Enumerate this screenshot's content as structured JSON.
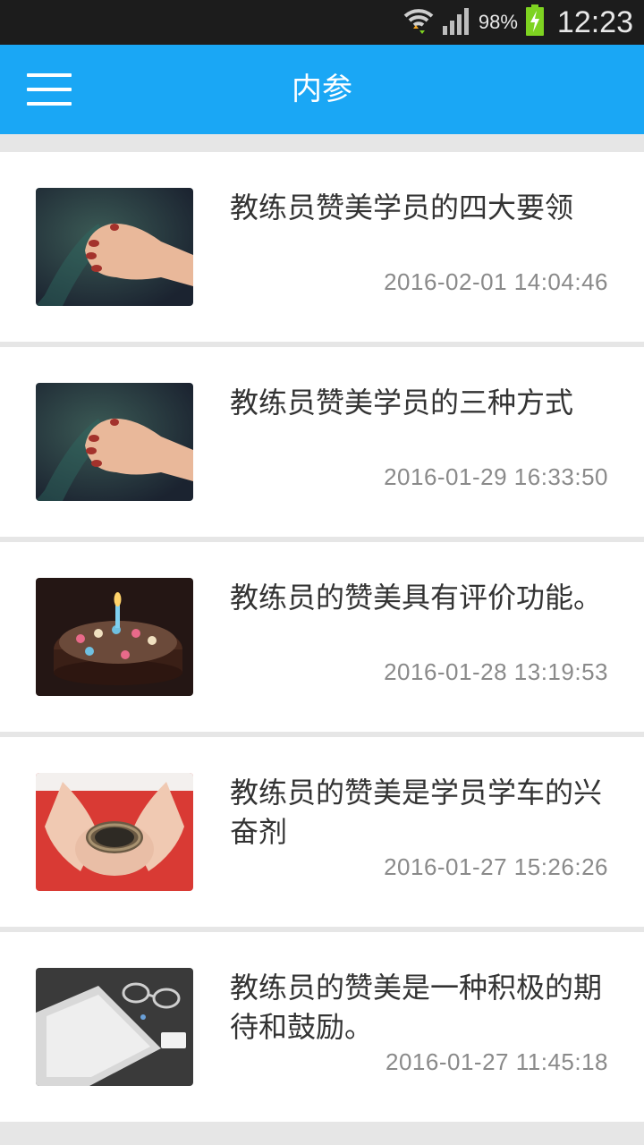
{
  "status_bar": {
    "battery_percent": "98%",
    "time": "12:23",
    "icons": [
      "wifi-icon",
      "signal-icon",
      "battery-charging-icon"
    ]
  },
  "header": {
    "title": "内参",
    "menu_icon": "hamburger-menu-icon",
    "background_color": "#1aa7f5"
  },
  "articles": [
    {
      "title": "教练员赞美学员的四大要领",
      "time": "2016-02-01 14:04:46",
      "thumbnail": "hand-photo"
    },
    {
      "title": "教练员赞美学员的三种方式",
      "time": "2016-01-29 16:33:50",
      "thumbnail": "hand-photo"
    },
    {
      "title": "教练员的赞美具有评价功能。",
      "time": "2016-01-28 13:19:53",
      "thumbnail": "cake-photo"
    },
    {
      "title": "教练员的赞美是学员学车的兴奋剂",
      "time": "2016-01-27 15:26:26",
      "thumbnail": "nest-photo"
    },
    {
      "title": "教练员的赞美是一种积极的期待和鼓励。",
      "time": "2016-01-27 11:45:18",
      "thumbnail": "tablet-glasses-photo"
    }
  ]
}
